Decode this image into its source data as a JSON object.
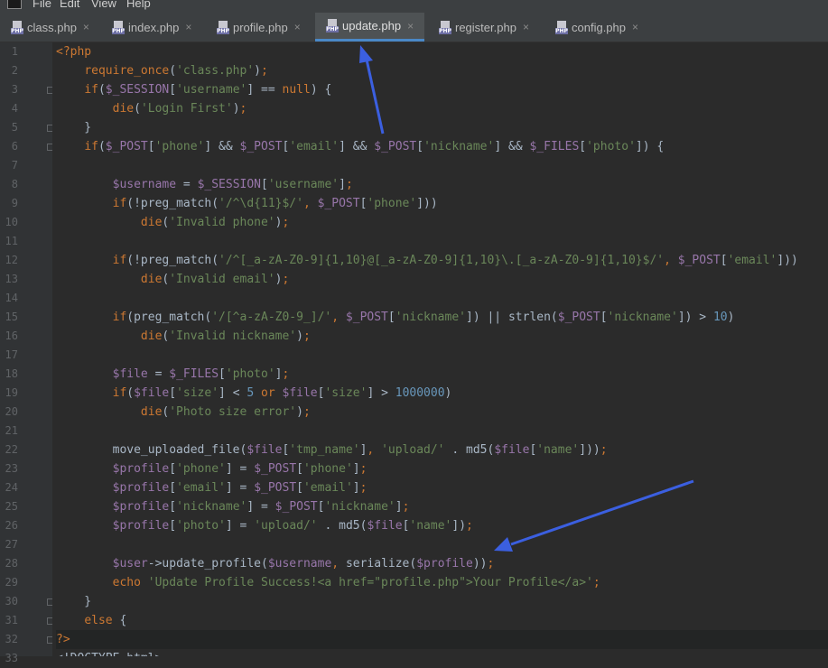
{
  "menubar": {
    "items": [
      {
        "label": "File"
      },
      {
        "label": "Edit"
      },
      {
        "label": "View"
      },
      {
        "label": "Help"
      }
    ]
  },
  "tabs": [
    {
      "label": "class.php",
      "active": false
    },
    {
      "label": "index.php",
      "active": false
    },
    {
      "label": "profile.php",
      "active": false
    },
    {
      "label": "update.php",
      "active": true
    },
    {
      "label": "register.php",
      "active": false
    },
    {
      "label": "config.php",
      "active": false
    }
  ],
  "tab_icon_badge": "PHP",
  "tab_close_glyph": "×",
  "colors": {
    "background": "#2b2b2b",
    "gutter": "#313335",
    "keyword": "#cc7832",
    "variable": "#9876aa",
    "string": "#6a8759",
    "number": "#6897bb",
    "function": "#ffc66d",
    "plain": "#a9b7c6",
    "arrow": "#3b5fe0"
  },
  "code": {
    "lines": [
      {
        "num": "1",
        "tokens": [
          {
            "c": "k",
            "t": "<?php"
          }
        ]
      },
      {
        "num": "2",
        "tokens": [
          {
            "c": "t",
            "t": "    "
          },
          {
            "c": "k",
            "t": "require_once"
          },
          {
            "c": "t",
            "t": "("
          },
          {
            "c": "s",
            "t": "'class.php'"
          },
          {
            "c": "t",
            "t": ")"
          },
          {
            "c": "k",
            "t": ";"
          }
        ]
      },
      {
        "num": "3",
        "tokens": [
          {
            "c": "t",
            "t": "    "
          },
          {
            "c": "k",
            "t": "if"
          },
          {
            "c": "t",
            "t": "("
          },
          {
            "c": "v",
            "t": "$_SESSION"
          },
          {
            "c": "t",
            "t": "["
          },
          {
            "c": "s",
            "t": "'username'"
          },
          {
            "c": "t",
            "t": "] == "
          },
          {
            "c": "k",
            "t": "null"
          },
          {
            "c": "t",
            "t": ") {"
          }
        ]
      },
      {
        "num": "4",
        "tokens": [
          {
            "c": "t",
            "t": "        "
          },
          {
            "c": "k",
            "t": "die"
          },
          {
            "c": "t",
            "t": "("
          },
          {
            "c": "s",
            "t": "'Login First'"
          },
          {
            "c": "t",
            "t": ")"
          },
          {
            "c": "k",
            "t": ";"
          }
        ]
      },
      {
        "num": "5",
        "tokens": [
          {
            "c": "t",
            "t": "    }"
          }
        ]
      },
      {
        "num": "6",
        "tokens": [
          {
            "c": "t",
            "t": "    "
          },
          {
            "c": "k",
            "t": "if"
          },
          {
            "c": "t",
            "t": "("
          },
          {
            "c": "v",
            "t": "$_POST"
          },
          {
            "c": "t",
            "t": "["
          },
          {
            "c": "s",
            "t": "'phone'"
          },
          {
            "c": "t",
            "t": "] && "
          },
          {
            "c": "v",
            "t": "$_POST"
          },
          {
            "c": "t",
            "t": "["
          },
          {
            "c": "s",
            "t": "'email'"
          },
          {
            "c": "t",
            "t": "] && "
          },
          {
            "c": "v",
            "t": "$_POST"
          },
          {
            "c": "t",
            "t": "["
          },
          {
            "c": "s",
            "t": "'nickname'"
          },
          {
            "c": "t",
            "t": "] && "
          },
          {
            "c": "v",
            "t": "$_FILES"
          },
          {
            "c": "t",
            "t": "["
          },
          {
            "c": "s",
            "t": "'photo'"
          },
          {
            "c": "t",
            "t": "]) {"
          }
        ]
      },
      {
        "num": "7",
        "tokens": []
      },
      {
        "num": "8",
        "tokens": [
          {
            "c": "t",
            "t": "        "
          },
          {
            "c": "v",
            "t": "$username"
          },
          {
            "c": "t",
            "t": " = "
          },
          {
            "c": "v",
            "t": "$_SESSION"
          },
          {
            "c": "t",
            "t": "["
          },
          {
            "c": "s",
            "t": "'username'"
          },
          {
            "c": "t",
            "t": "]"
          },
          {
            "c": "k",
            "t": ";"
          }
        ]
      },
      {
        "num": "9",
        "tokens": [
          {
            "c": "t",
            "t": "        "
          },
          {
            "c": "k",
            "t": "if"
          },
          {
            "c": "t",
            "t": "(!preg_match("
          },
          {
            "c": "s",
            "t": "'/^\\d{11}$/'"
          },
          {
            "c": "k",
            "t": ", "
          },
          {
            "c": "v",
            "t": "$_POST"
          },
          {
            "c": "t",
            "t": "["
          },
          {
            "c": "s",
            "t": "'phone'"
          },
          {
            "c": "t",
            "t": "]))"
          }
        ]
      },
      {
        "num": "10",
        "tokens": [
          {
            "c": "t",
            "t": "            "
          },
          {
            "c": "k",
            "t": "die"
          },
          {
            "c": "t",
            "t": "("
          },
          {
            "c": "s",
            "t": "'Invalid phone'"
          },
          {
            "c": "t",
            "t": ")"
          },
          {
            "c": "k",
            "t": ";"
          }
        ]
      },
      {
        "num": "11",
        "tokens": []
      },
      {
        "num": "12",
        "tokens": [
          {
            "c": "t",
            "t": "        "
          },
          {
            "c": "k",
            "t": "if"
          },
          {
            "c": "t",
            "t": "(!preg_match("
          },
          {
            "c": "s",
            "t": "'/^[_a-zA-Z0-9]{1,10}@[_a-zA-Z0-9]{1,10}\\.[_a-zA-Z0-9]{1,10}$/'"
          },
          {
            "c": "k",
            "t": ", "
          },
          {
            "c": "v",
            "t": "$_POST"
          },
          {
            "c": "t",
            "t": "["
          },
          {
            "c": "s",
            "t": "'email'"
          },
          {
            "c": "t",
            "t": "]))"
          }
        ]
      },
      {
        "num": "13",
        "tokens": [
          {
            "c": "t",
            "t": "            "
          },
          {
            "c": "k",
            "t": "die"
          },
          {
            "c": "t",
            "t": "("
          },
          {
            "c": "s",
            "t": "'Invalid email'"
          },
          {
            "c": "t",
            "t": ")"
          },
          {
            "c": "k",
            "t": ";"
          }
        ]
      },
      {
        "num": "14",
        "tokens": []
      },
      {
        "num": "15",
        "tokens": [
          {
            "c": "t",
            "t": "        "
          },
          {
            "c": "k",
            "t": "if"
          },
          {
            "c": "t",
            "t": "(preg_match("
          },
          {
            "c": "s",
            "t": "'/[^a-zA-Z0-9_]/'"
          },
          {
            "c": "k",
            "t": ", "
          },
          {
            "c": "v",
            "t": "$_POST"
          },
          {
            "c": "t",
            "t": "["
          },
          {
            "c": "s",
            "t": "'nickname'"
          },
          {
            "c": "t",
            "t": "]) || strlen("
          },
          {
            "c": "v",
            "t": "$_POST"
          },
          {
            "c": "t",
            "t": "["
          },
          {
            "c": "s",
            "t": "'nickname'"
          },
          {
            "c": "t",
            "t": "]) > "
          },
          {
            "c": "n",
            "t": "10"
          },
          {
            "c": "t",
            "t": ")"
          }
        ]
      },
      {
        "num": "16",
        "tokens": [
          {
            "c": "t",
            "t": "            "
          },
          {
            "c": "k",
            "t": "die"
          },
          {
            "c": "t",
            "t": "("
          },
          {
            "c": "s",
            "t": "'Invalid nickname'"
          },
          {
            "c": "t",
            "t": ")"
          },
          {
            "c": "k",
            "t": ";"
          }
        ]
      },
      {
        "num": "17",
        "tokens": []
      },
      {
        "num": "18",
        "tokens": [
          {
            "c": "t",
            "t": "        "
          },
          {
            "c": "v",
            "t": "$file"
          },
          {
            "c": "t",
            "t": " = "
          },
          {
            "c": "v",
            "t": "$_FILES"
          },
          {
            "c": "t",
            "t": "["
          },
          {
            "c": "s",
            "t": "'photo'"
          },
          {
            "c": "t",
            "t": "]"
          },
          {
            "c": "k",
            "t": ";"
          }
        ]
      },
      {
        "num": "19",
        "tokens": [
          {
            "c": "t",
            "t": "        "
          },
          {
            "c": "k",
            "t": "if"
          },
          {
            "c": "t",
            "t": "("
          },
          {
            "c": "v",
            "t": "$file"
          },
          {
            "c": "t",
            "t": "["
          },
          {
            "c": "s",
            "t": "'size'"
          },
          {
            "c": "t",
            "t": "] < "
          },
          {
            "c": "n",
            "t": "5"
          },
          {
            "c": "t",
            "t": " "
          },
          {
            "c": "k",
            "t": "or"
          },
          {
            "c": "t",
            "t": " "
          },
          {
            "c": "v",
            "t": "$file"
          },
          {
            "c": "t",
            "t": "["
          },
          {
            "c": "s",
            "t": "'size'"
          },
          {
            "c": "t",
            "t": "] > "
          },
          {
            "c": "n",
            "t": "1000000"
          },
          {
            "c": "t",
            "t": ")"
          }
        ]
      },
      {
        "num": "20",
        "tokens": [
          {
            "c": "t",
            "t": "            "
          },
          {
            "c": "k",
            "t": "die"
          },
          {
            "c": "t",
            "t": "("
          },
          {
            "c": "s",
            "t": "'Photo size error'"
          },
          {
            "c": "t",
            "t": ")"
          },
          {
            "c": "k",
            "t": ";"
          }
        ]
      },
      {
        "num": "21",
        "tokens": []
      },
      {
        "num": "22",
        "tokens": [
          {
            "c": "t",
            "t": "        move_uploaded_file("
          },
          {
            "c": "v",
            "t": "$file"
          },
          {
            "c": "t",
            "t": "["
          },
          {
            "c": "s",
            "t": "'tmp_name'"
          },
          {
            "c": "t",
            "t": "]"
          },
          {
            "c": "k",
            "t": ", "
          },
          {
            "c": "s",
            "t": "'upload/'"
          },
          {
            "c": "t",
            "t": " . md5("
          },
          {
            "c": "v",
            "t": "$file"
          },
          {
            "c": "t",
            "t": "["
          },
          {
            "c": "s",
            "t": "'name'"
          },
          {
            "c": "t",
            "t": "]))"
          },
          {
            "c": "k",
            "t": ";"
          }
        ]
      },
      {
        "num": "23",
        "tokens": [
          {
            "c": "t",
            "t": "        "
          },
          {
            "c": "v",
            "t": "$profile"
          },
          {
            "c": "t",
            "t": "["
          },
          {
            "c": "s",
            "t": "'phone'"
          },
          {
            "c": "t",
            "t": "] = "
          },
          {
            "c": "v",
            "t": "$_POST"
          },
          {
            "c": "t",
            "t": "["
          },
          {
            "c": "s",
            "t": "'phone'"
          },
          {
            "c": "t",
            "t": "]"
          },
          {
            "c": "k",
            "t": ";"
          }
        ]
      },
      {
        "num": "24",
        "tokens": [
          {
            "c": "t",
            "t": "        "
          },
          {
            "c": "v",
            "t": "$profile"
          },
          {
            "c": "t",
            "t": "["
          },
          {
            "c": "s",
            "t": "'email'"
          },
          {
            "c": "t",
            "t": "] = "
          },
          {
            "c": "v",
            "t": "$_POST"
          },
          {
            "c": "t",
            "t": "["
          },
          {
            "c": "s",
            "t": "'email'"
          },
          {
            "c": "t",
            "t": "]"
          },
          {
            "c": "k",
            "t": ";"
          }
        ]
      },
      {
        "num": "25",
        "tokens": [
          {
            "c": "t",
            "t": "        "
          },
          {
            "c": "v",
            "t": "$profile"
          },
          {
            "c": "t",
            "t": "["
          },
          {
            "c": "s",
            "t": "'nickname'"
          },
          {
            "c": "t",
            "t": "] = "
          },
          {
            "c": "v",
            "t": "$_POST"
          },
          {
            "c": "t",
            "t": "["
          },
          {
            "c": "s",
            "t": "'nickname'"
          },
          {
            "c": "t",
            "t": "]"
          },
          {
            "c": "k",
            "t": ";"
          }
        ]
      },
      {
        "num": "26",
        "tokens": [
          {
            "c": "t",
            "t": "        "
          },
          {
            "c": "v",
            "t": "$profile"
          },
          {
            "c": "t",
            "t": "["
          },
          {
            "c": "s",
            "t": "'photo'"
          },
          {
            "c": "t",
            "t": "] = "
          },
          {
            "c": "s",
            "t": "'upload/'"
          },
          {
            "c": "t",
            "t": " . md5("
          },
          {
            "c": "v",
            "t": "$file"
          },
          {
            "c": "t",
            "t": "["
          },
          {
            "c": "s",
            "t": "'name'"
          },
          {
            "c": "t",
            "t": "])"
          },
          {
            "c": "k",
            "t": ";"
          }
        ]
      },
      {
        "num": "27",
        "tokens": []
      },
      {
        "num": "28",
        "tokens": [
          {
            "c": "t",
            "t": "        "
          },
          {
            "c": "v",
            "t": "$user"
          },
          {
            "c": "t",
            "t": "->update_profile("
          },
          {
            "c": "v",
            "t": "$username"
          },
          {
            "c": "k",
            "t": ", "
          },
          {
            "c": "t",
            "t": "serialize("
          },
          {
            "c": "v",
            "t": "$profile"
          },
          {
            "c": "t",
            "t": "))"
          },
          {
            "c": "k",
            "t": ";"
          }
        ]
      },
      {
        "num": "29",
        "tokens": [
          {
            "c": "t",
            "t": "        "
          },
          {
            "c": "k",
            "t": "echo "
          },
          {
            "c": "s",
            "t": "'Update Profile Success!<a href=\"profile.php\">Your Profile</a>'"
          },
          {
            "c": "k",
            "t": ";"
          }
        ]
      },
      {
        "num": "30",
        "tokens": [
          {
            "c": "t",
            "t": "    }"
          }
        ]
      },
      {
        "num": "31",
        "tokens": [
          {
            "c": "t",
            "t": "    "
          },
          {
            "c": "k",
            "t": "else"
          },
          {
            "c": "t",
            "t": " {"
          }
        ]
      },
      {
        "num": "32",
        "tokens": [
          {
            "c": "k",
            "t": "?>"
          }
        ]
      },
      {
        "num": "33",
        "tokens": [
          {
            "c": "t",
            "t": "<!DOCTYPE html>"
          }
        ]
      }
    ]
  }
}
